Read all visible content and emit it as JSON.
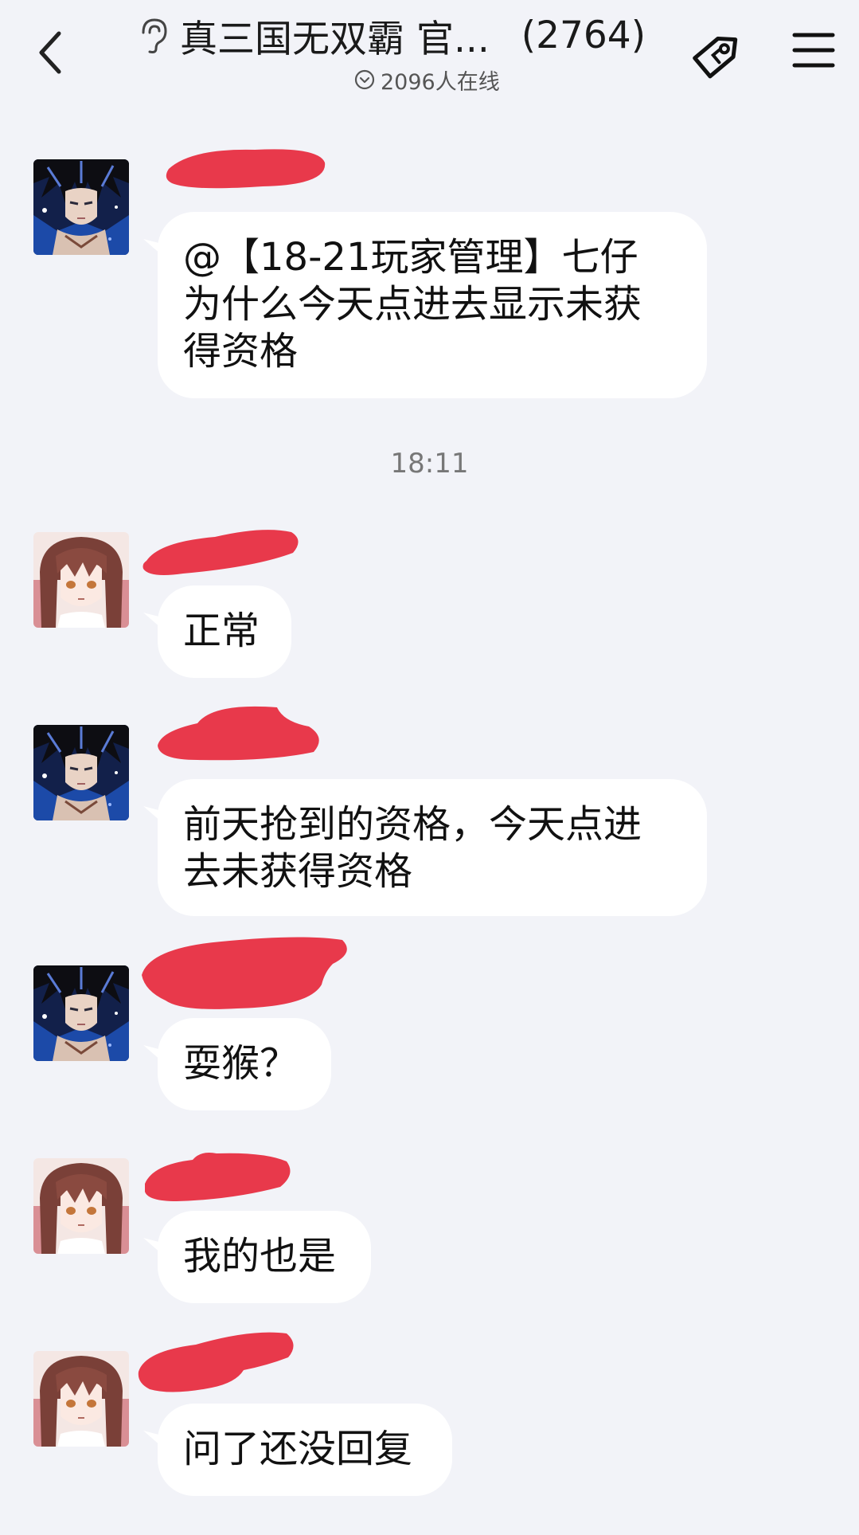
{
  "header": {
    "title": "真三国无双霸 官...",
    "member_count": "(2764)",
    "online_text": "2096人在线"
  },
  "timestamp": "18:11",
  "colors": {
    "background": "#f2f3f8",
    "bubble": "#ffffff",
    "redaction": "#e8394b"
  },
  "messages": [
    {
      "avatar": "goku-avatar",
      "text": "@【18-21玩家管理】七仔\n为什么今天点进去显示未获\n得资格"
    },
    {
      "avatar": "anime-girl-avatar",
      "text": "正常"
    },
    {
      "avatar": "goku-avatar",
      "text": "前天抢到的资格，今天点进\n去未获得资格"
    },
    {
      "avatar": "goku-avatar",
      "text": "耍猴？"
    },
    {
      "avatar": "anime-girl-avatar",
      "text": "我的也是"
    },
    {
      "avatar": "anime-girl-avatar",
      "text": "问了还没回复"
    }
  ]
}
